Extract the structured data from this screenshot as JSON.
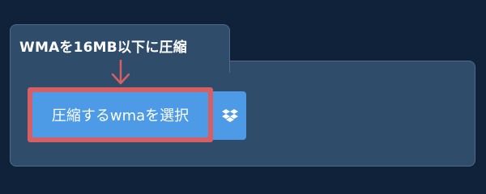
{
  "card": {
    "title": "WMAを16MB以下に圧縮"
  },
  "upload": {
    "select_label": "圧縮するwmaを選択",
    "dropbox_icon": "dropbox-icon"
  },
  "colors": {
    "page_bg": "#10213a",
    "card_bg": "#2f4c6b",
    "button": "#4d9ae6",
    "highlight": "#d65f63"
  }
}
